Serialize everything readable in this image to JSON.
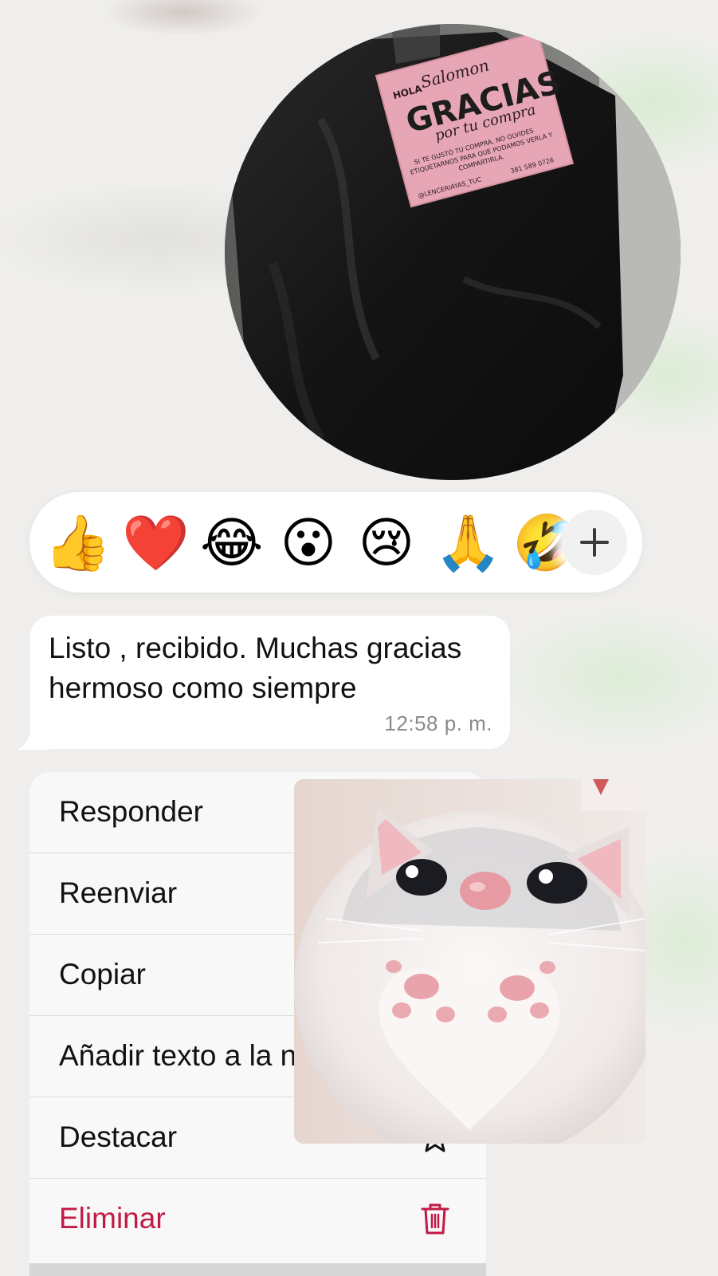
{
  "video_message": {
    "sticker_text": {
      "greeting": "HOLA",
      "name": "Salomon",
      "headline": "GRACIAS",
      "subline": "por tu compra",
      "body_line1": "SI TE GUSTÓ TU COMPRA, NO OLVIDES",
      "body_line2": "ETIQUETARNOS PARA QUE PODAMOS VERLA Y",
      "body_line3": "COMPARTIRLA.",
      "handle": "@LENCERIAYAS_TUC",
      "phone": "381 589 0726"
    }
  },
  "reactions": [
    {
      "icon": "thumbs-up-emoji",
      "glyph": "👍"
    },
    {
      "icon": "red-heart-emoji",
      "glyph": "❤️"
    },
    {
      "icon": "tears-of-joy-emoji",
      "glyph": "😂"
    },
    {
      "icon": "surprised-face-emoji",
      "glyph": "😮"
    },
    {
      "icon": "crying-face-emoji",
      "glyph": "😢"
    },
    {
      "icon": "folded-hands-emoji",
      "glyph": "🙏"
    },
    {
      "icon": "rolling-laughing-emoji",
      "glyph": "🤣"
    }
  ],
  "reaction_more_icon": "plus-icon",
  "message": {
    "text": "Listo , recibido. Muchas gracias hermoso como siempre",
    "time": "12:58 p. m."
  },
  "menu": {
    "items": [
      {
        "label": "Responder"
      },
      {
        "label": "Reenviar"
      },
      {
        "label": "Copiar"
      },
      {
        "label": "Añadir texto a la n"
      },
      {
        "label": "Destacar",
        "icon": "star-icon"
      },
      {
        "label": "Eliminar",
        "icon": "trash-icon"
      }
    ]
  },
  "sticker": {
    "icon": "cat-heart-paws-sticker"
  },
  "colors": {
    "background": "#efeeec",
    "danger": "#c21a46",
    "bubble": "#ffffff",
    "menu": "#f8f8f8"
  }
}
